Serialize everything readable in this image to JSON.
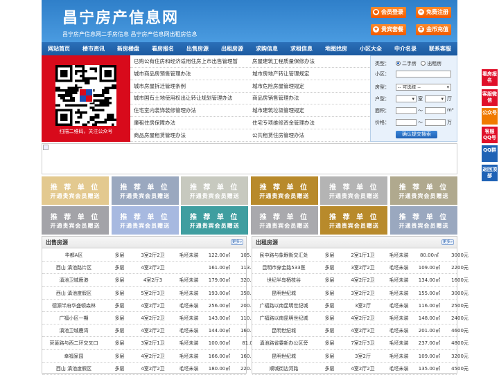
{
  "header": {
    "title": "昌宁房产信息网",
    "subtitle": "昌宁房产信息网二手房信息    昌宁房产信息网出租房信息",
    "buttons": [
      {
        "label": "会员登录",
        "icon": "user-icon"
      },
      {
        "label": "免费注册",
        "icon": "register-icon"
      },
      {
        "label": "贵宾套餐",
        "icon": "vip-icon"
      },
      {
        "label": "金币充值",
        "icon": "coin-icon"
      }
    ]
  },
  "nav": [
    "网站首页",
    "楼市资讯",
    "新房楼盘",
    "看房报名",
    "出售房源",
    "出租房源",
    "求购信息",
    "求租信息",
    "地图找房",
    "小区大全",
    "中介名录",
    "联系客服"
  ],
  "qr": {
    "caption": "扫描二维码，关注公众号"
  },
  "news": [
    [
      "已购公有住房和经济适用住房上市出售管理暂",
      "房屋建筑工程质量保修办法"
    ],
    [
      "城市商品房预售管理办法",
      "城市房地产转让管理规定"
    ],
    [
      "城市房屋拆迁管理条例",
      "城市危险房屋管理规定"
    ],
    [
      "城市国有土地使用权出让转让规划管理办法",
      "商品房销售管理办法"
    ],
    [
      "住宅室内装饰装修管理办法",
      "城市建筑垃圾管理规定"
    ],
    [
      "廉租住房保障办法",
      "住宅专项维修资金管理办法"
    ],
    [
      "商品房屋租赁管理办法",
      "公共租赁住房管理办法"
    ]
  ],
  "search": {
    "type_label": "类型：",
    "type_options": [
      "二手房",
      "出租房"
    ],
    "community_label": "小区：",
    "house_label": "房型：",
    "house_select": "-- 可选择 --",
    "room_label": "户型：",
    "room_unit1": "室",
    "room_unit2": "厅",
    "area_label": "面积：",
    "area_sep": "～",
    "area_unit": "m²",
    "price_label": "价格：",
    "price_sep": "～",
    "price_unit": "万",
    "submit": "确认提交搜索"
  },
  "recommend": {
    "line1": "推 荐 单 位",
    "line2": "开通贵宾会员赠送",
    "colors": [
      "#e3c98f",
      "#9aa8bf",
      "#c7c9bf",
      "#b88a2b",
      "#b4b4b4",
      "#b0a98e",
      "#a3a3a8",
      "#a7b9e0",
      "#3f9ea0",
      "#a9a9ad",
      "#b88a2b",
      "#9aa8bf"
    ]
  },
  "sale": {
    "title": "出售房源",
    "more": "更多»",
    "rows": [
      [
        "华都A区",
        "多层",
        "3室2厅2卫",
        "毛坯未装",
        "122.00㎡",
        "105.0万"
      ],
      [
        "西山 滇池路片区",
        "多层",
        "4室2厅2卫",
        "161.00㎡",
        "113.0万"
      ],
      [
        "滇池卫城鹿港",
        "多层",
        "4室2厅3",
        "毛坯未装",
        "179.00㎡",
        "320.0万"
      ],
      [
        "西山 滇池度假区",
        "多层",
        "5室2厅3卫",
        "毛坯未装",
        "193.00㎡",
        "358.0万"
      ],
      [
        "德源半府华盛顿森林",
        "多层",
        "4室2厅2卫",
        "毛坯未装",
        "256.00㎡",
        "200.0万"
      ],
      [
        "广福小区一期",
        "多层",
        "4室2厅2卫",
        "毛坯未装",
        "143.00㎡",
        "110.0万"
      ],
      [
        "滇池卫城鹿湾",
        "多层",
        "4室2厅2卫",
        "毛坯未装",
        "144.00㎡",
        "160.0万"
      ],
      [
        "荧菱路与西二环交叉口",
        "多层",
        "3室2厅1卫",
        "毛坯未装",
        "100.00㎡",
        "81.0万"
      ],
      [
        "幸福家园",
        "多层",
        "4室2厅2卫",
        "毛坯未装",
        "166.00㎡",
        "160.0万"
      ],
      [
        "西山 滇池度假区",
        "多层",
        "4室2厅2卫",
        "毛坯未装",
        "180.00㎡",
        "220.0万"
      ]
    ]
  },
  "rent": {
    "title": "出租房源",
    "more": "更多»",
    "rows": [
      [
        "民中路与象眼街交汇处",
        "多层",
        "2室1厅1卫",
        "毛坯未装",
        "80.00㎡",
        "3000元"
      ],
      [
        "昆明市穿金路533医",
        "多层",
        "3室2厅2卫",
        "毛坯未装",
        "109.00㎡",
        "2200元"
      ],
      [
        "世纪半岛栖枝谷",
        "多层",
        "4室2厅2卫",
        "毛坯未装",
        "134.00㎡",
        "1600元"
      ],
      [
        "昆明世纪城",
        "多层",
        "3室2厅2卫",
        "毛坯未装",
        "155.00㎡",
        "3000元"
      ],
      [
        "广福路以南昆明世纪城",
        "多层",
        "3室2厅",
        "毛坯未装",
        "116.00㎡",
        "2500元"
      ],
      [
        "广福路以南昆明世纪城",
        "多层",
        "4室2厅2卫",
        "毛坯未装",
        "148.00㎡",
        "2400元"
      ],
      [
        "昆明世纪城",
        "多层",
        "4室2厅3卫",
        "毛坯未装",
        "201.00㎡",
        "4600元"
      ],
      [
        "滇池路省委新办公区旁",
        "多层",
        "7室2厅3卫",
        "毛坯未装",
        "237.00㎡",
        "4800元"
      ],
      [
        "昆明世纪城",
        "多层",
        "3室2厅",
        "毛坯未装",
        "109.00㎡",
        "3200元"
      ],
      [
        "顺城街边河路",
        "多层",
        "4室2厅2卫",
        "毛坯未装",
        "135.00㎡",
        "4500元"
      ]
    ]
  },
  "side": [
    {
      "label": "看房报名",
      "color": "#e0102a"
    },
    {
      "label": "客服微信",
      "color": "#e0102a"
    },
    {
      "label": "公众号",
      "color": "#f07a00"
    },
    {
      "label": "客服QQ号",
      "color": "#e0102a"
    },
    {
      "label": "QQ群",
      "color": "#1f62b5"
    },
    {
      "label": "返回顶部",
      "color": "#1f62b5"
    }
  ]
}
